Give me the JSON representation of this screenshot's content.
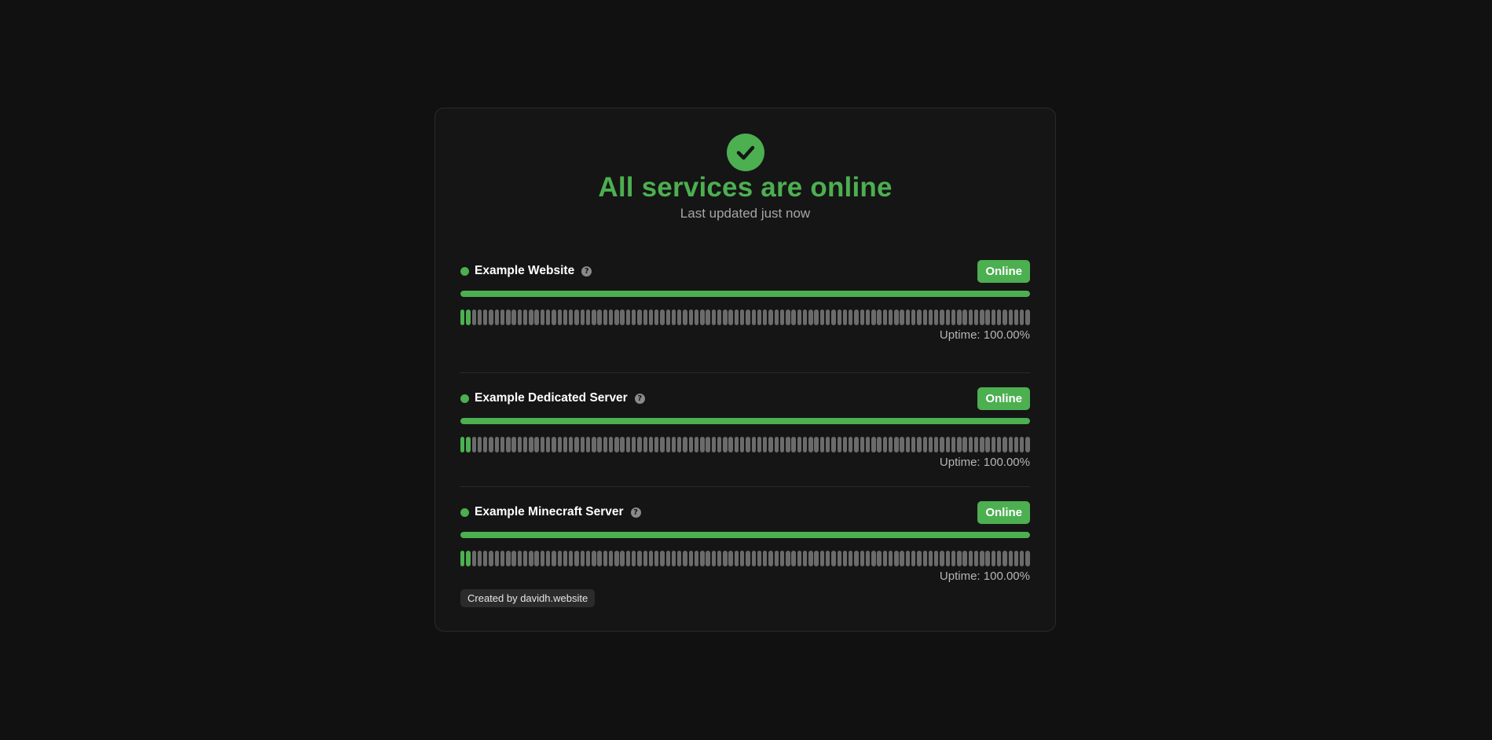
{
  "header": {
    "icon": "check-circle-icon",
    "title": "All services are online",
    "subtitle": "Last updated just now"
  },
  "colors": {
    "accent": "#4caf50",
    "background": "#111111",
    "card": "#151515",
    "tick_idle": "#6b6b6b"
  },
  "services": [
    {
      "name": "Example Website",
      "status": "Online",
      "status_icon": "status-dot-icon",
      "help_icon": "question-circle-icon",
      "progress": 1.0,
      "ticks_total": 100,
      "ticks_up": 2,
      "uptime": "Uptime: 100.00%"
    },
    {
      "name": "Example Dedicated Server",
      "status": "Online",
      "status_icon": "status-dot-icon",
      "help_icon": "question-circle-icon",
      "progress": 1.0,
      "ticks_total": 100,
      "ticks_up": 2,
      "uptime": "Uptime: 100.00%"
    },
    {
      "name": "Example Minecraft Server",
      "status": "Online",
      "status_icon": "status-dot-icon",
      "help_icon": "question-circle-icon",
      "progress": 1.0,
      "ticks_total": 100,
      "ticks_up": 2,
      "uptime": "Uptime: 100.00%"
    }
  ],
  "footer": {
    "credit": "Created by davidh.website"
  }
}
